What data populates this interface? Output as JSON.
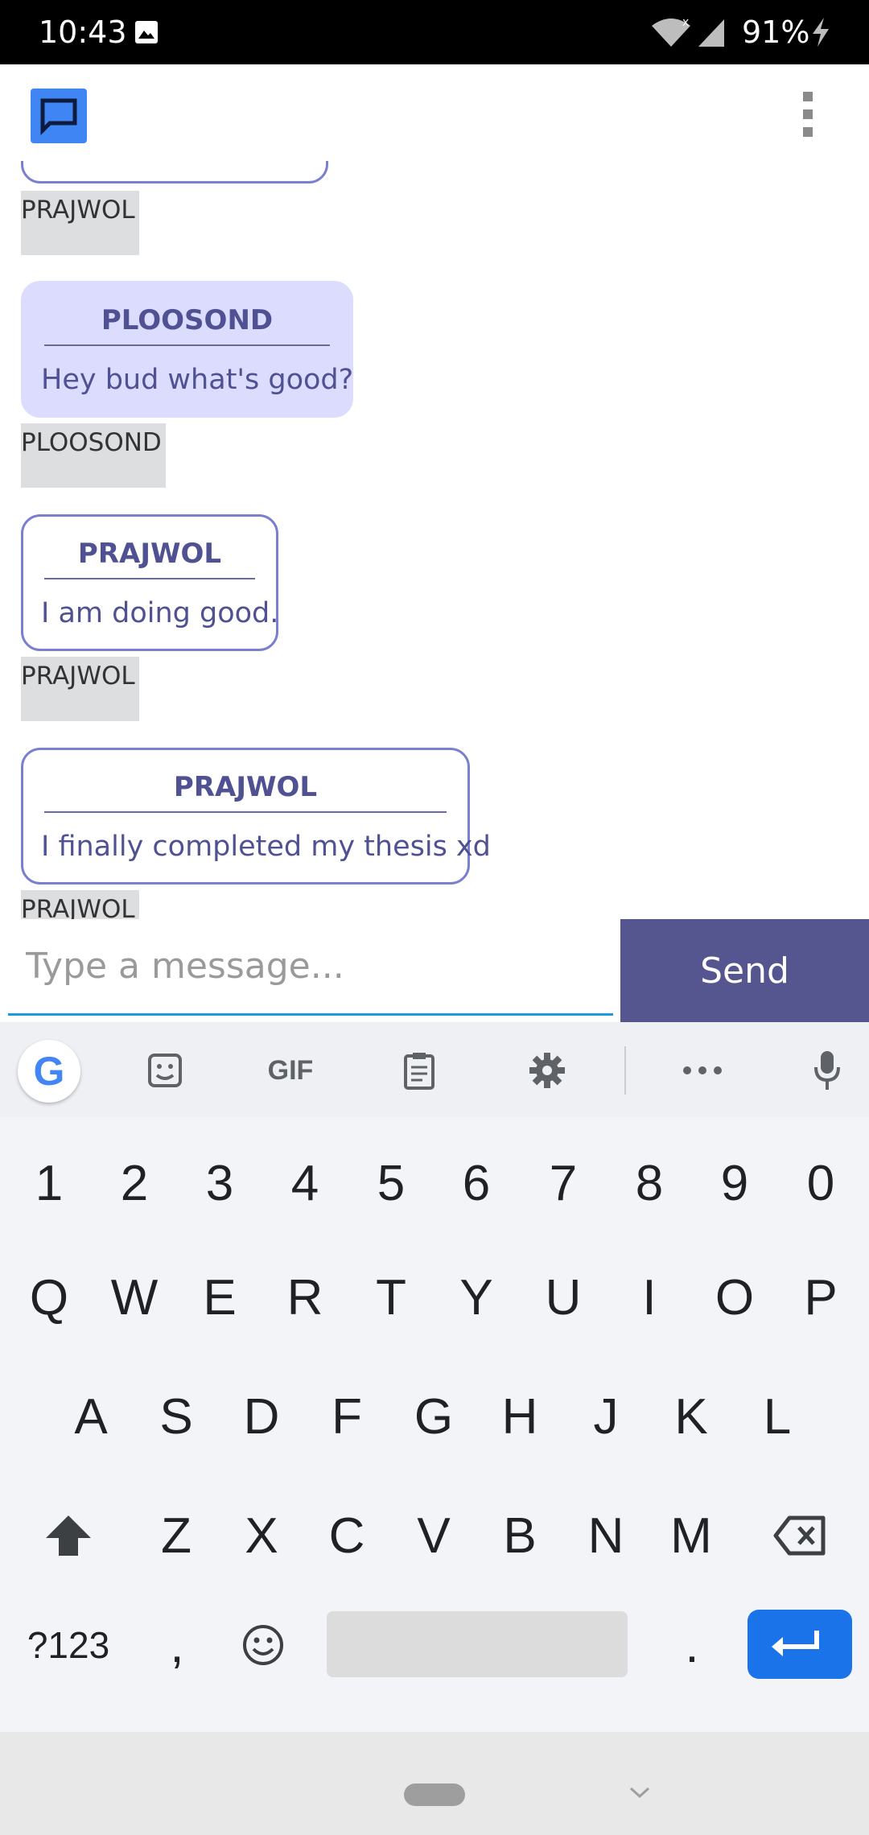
{
  "status_bar": {
    "time": "10:43",
    "battery": "91%",
    "icons": [
      "image-icon",
      "wifi-icon",
      "signal-icon",
      "charging-icon"
    ]
  },
  "app_bar": {
    "logo_icon": "chat-bubble-icon",
    "menu_icon": "overflow-menu-icon",
    "accent_color": "#3f86f4"
  },
  "chat": {
    "top_label": "PRAJWOL",
    "messages": [
      {
        "sender": "PLOOSOND",
        "text": "Hey bud what's good?",
        "label": "PLOOSOND",
        "style": "incoming"
      },
      {
        "sender": "PRAJWOL",
        "text": "I am doing good.",
        "label": "PRAJWOL",
        "style": "outgoing"
      },
      {
        "sender": "PRAJWOL",
        "text": "I finally completed my thesis xd",
        "label": "PRAJWOL",
        "style": "outgoing"
      }
    ]
  },
  "composer": {
    "placeholder": "Type a message...",
    "send_label": "Send",
    "send_color": "#55558f"
  },
  "keyboard": {
    "toolbar": {
      "google_label": "G",
      "gif_label": "GIF",
      "icons": [
        "google-icon",
        "sticker-icon",
        "gif-icon",
        "clipboard-icon",
        "settings-icon",
        "more-icon",
        "mic-icon"
      ]
    },
    "row_numbers": [
      "1",
      "2",
      "3",
      "4",
      "5",
      "6",
      "7",
      "8",
      "9",
      "0"
    ],
    "row_q": [
      "Q",
      "W",
      "E",
      "R",
      "T",
      "Y",
      "U",
      "I",
      "O",
      "P"
    ],
    "row_a": [
      "A",
      "S",
      "D",
      "F",
      "G",
      "H",
      "J",
      "K",
      "L"
    ],
    "row_z": [
      "Z",
      "X",
      "C",
      "V",
      "B",
      "N",
      "M"
    ],
    "symbols_label": "?123",
    "comma_label": ",",
    "period_label": ".",
    "enter_color": "#1a73e8"
  }
}
